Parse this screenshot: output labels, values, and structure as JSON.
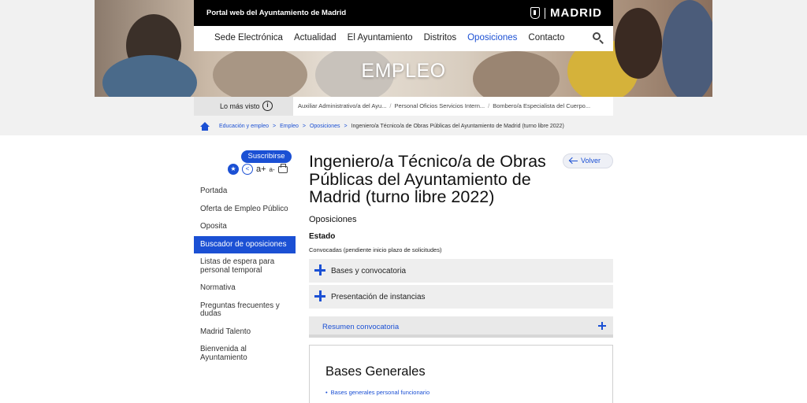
{
  "header": {
    "portal_text": "Portal web del Ayuntamiento de Madrid",
    "logo_text": "MADRID",
    "hero_title": "EMPLEO"
  },
  "nav": {
    "items": [
      "Sede Electrónica",
      "Actualidad",
      "El Ayuntamiento",
      "Distritos",
      "Oposiciones",
      "Contacto"
    ],
    "active": "Oposiciones",
    "search_icon": "search-icon"
  },
  "most_seen": {
    "label": "Lo más visto",
    "links": [
      "Auxiliar Administrativo/a del Ayu...",
      "Personal Oficios Servicios Intern...",
      "Bombero/a Especialista del Cuerpo..."
    ]
  },
  "breadcrumb": {
    "items": [
      "Educación y empleo",
      "Empleo",
      "Oposiciones"
    ],
    "current": "Ingeniero/a Técnico/a de Obras Públicas del Ayuntamiento de Madrid (turno libre 2022)"
  },
  "sidebar": {
    "subscribe_label": "Suscribirse",
    "font_larger": "a+",
    "font_smaller": "a-",
    "items": [
      "Portada",
      "Oferta de Empleo Público",
      "Oposita",
      "Buscador de oposiciones",
      "Listas de espera para personal temporal",
      "Normativa",
      "Preguntas frecuentes y dudas",
      "Madrid Talento",
      "Bienvenida al Ayuntamiento"
    ],
    "active_index": 3
  },
  "content": {
    "title": "Ingeniero/a Técnico/a de Obras Públicas del Ayuntamiento de Madrid (turno libre 2022)",
    "back_label": "Volver",
    "section": "Oposiciones",
    "estado_label": "Estado",
    "estado_value": "Convocadas (pendiente inicio plazo de solicitudes)",
    "accordions": [
      "Bases y convocatoria",
      "Presentación de instancias"
    ],
    "resumen_label": "Resumen convocatoria",
    "bases_title": "Bases Generales",
    "bases_item": "Bases generales personal funcionario"
  },
  "colors": {
    "accent": "#1b50d4",
    "topbar": "#000000",
    "accordion_bg": "#eeeeee"
  }
}
